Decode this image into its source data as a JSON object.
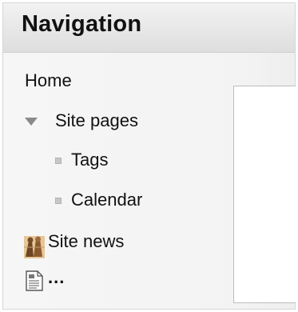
{
  "navigation": {
    "title": "Navigation",
    "items": [
      {
        "label": "Home"
      },
      {
        "label": "Site pages",
        "expanded": true,
        "icon": "expand-triangle-icon"
      },
      {
        "label": "Tags",
        "icon": "bullet-icon"
      },
      {
        "label": "Calendar",
        "icon": "bullet-icon"
      },
      {
        "label": "Site news",
        "icon": "forum-icon"
      },
      {
        "label": "...",
        "icon": "document-icon"
      }
    ]
  },
  "colors": {
    "header_bg": "#e6e6e6",
    "block_bg": "#f4f4f4",
    "text": "#111111",
    "panel_border": "#bdbdbd"
  }
}
